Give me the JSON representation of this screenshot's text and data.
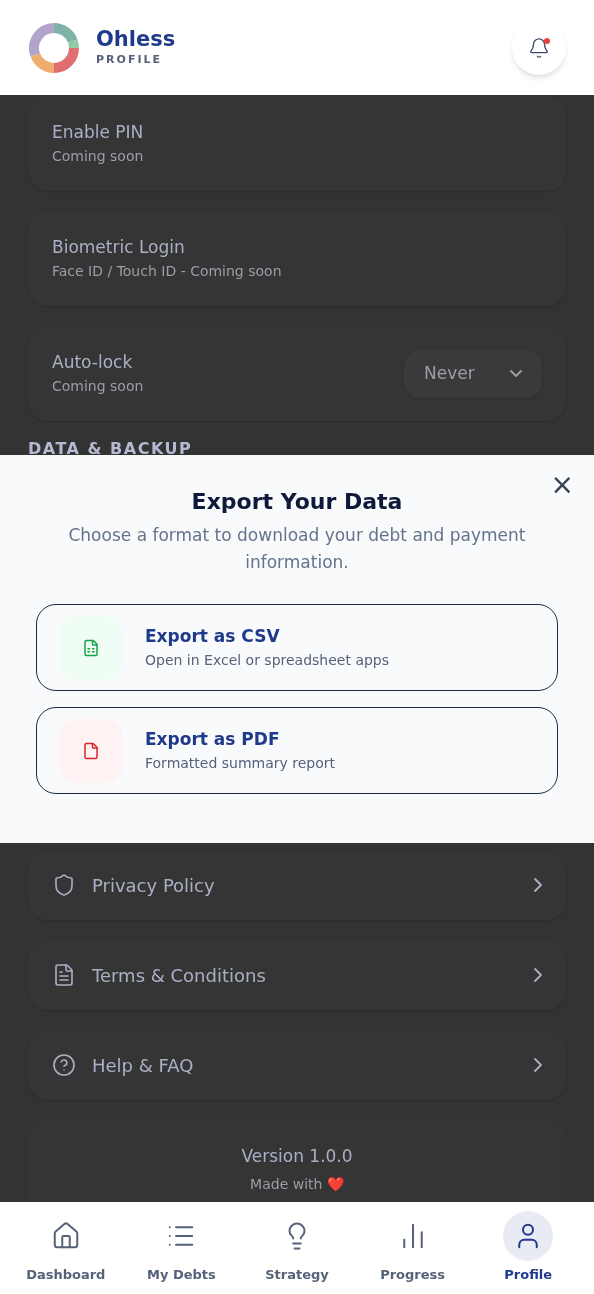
{
  "header": {
    "app_name": "Ohless",
    "page": "PROFILE",
    "notification_dot": true
  },
  "settings": [
    {
      "title": "Enable PIN",
      "subtitle": "Coming soon"
    },
    {
      "title": "Biometric Login",
      "subtitle": "Face ID / Touch ID - Coming soon"
    },
    {
      "title": "Auto-lock",
      "subtitle": "Coming soon",
      "value": "Never"
    }
  ],
  "section_heading": "DATA & BACKUP",
  "modal": {
    "title": "Export Your Data",
    "description": "Choose a format to download your debt and payment information.",
    "close": "×",
    "options": [
      {
        "kind": "csv",
        "title": "Export as CSV",
        "subtitle": "Open in Excel or spreadsheet apps"
      },
      {
        "kind": "pdf",
        "title": "Export as PDF",
        "subtitle": "Formatted summary report"
      }
    ]
  },
  "links": [
    {
      "kind": "shield",
      "label": "Privacy Policy"
    },
    {
      "kind": "document",
      "label": "Terms & Conditions"
    },
    {
      "kind": "help",
      "label": "Help & FAQ"
    }
  ],
  "footer": {
    "version": "Version 1.0.0",
    "made_with": "Made with ❤️"
  },
  "nav": [
    {
      "kind": "home",
      "label": "Dashboard",
      "selected": false
    },
    {
      "kind": "list",
      "label": "My Debts",
      "selected": false
    },
    {
      "kind": "bulb",
      "label": "Strategy",
      "selected": false
    },
    {
      "kind": "chart",
      "label": "Progress",
      "selected": false
    },
    {
      "kind": "user",
      "label": "Profile",
      "selected": true
    }
  ]
}
